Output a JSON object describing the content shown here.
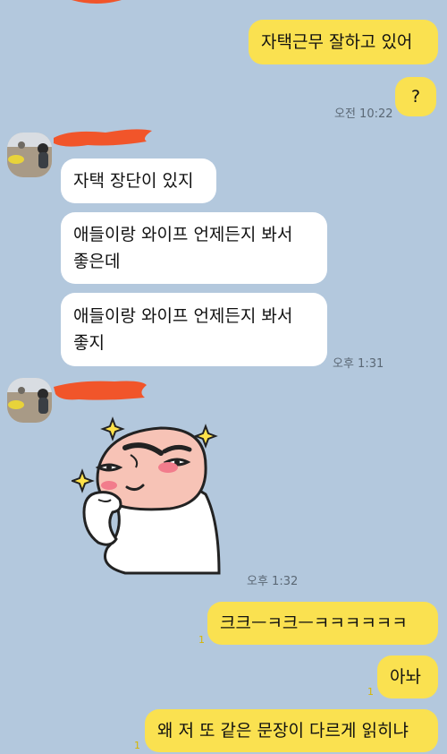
{
  "chat": {
    "me": {
      "msg1": "자택근무 잘하고 있어",
      "msg2": "?",
      "time1": "오전 10:22"
    },
    "them": {
      "msg1": "자택 장단이 있지",
      "msg2_l1": "애들이랑 와이프 언제든지 봐서",
      "msg2_l2": "좋은데",
      "msg3_l1": "애들이랑 와이프 언제든지 봐서",
      "msg3_l2": "좋지",
      "time1": "오후 1:31",
      "sticker_icon": "peach-character-smirk-sticker",
      "time2": "오후 1:32"
    },
    "reply": {
      "msg1": "크크ㅡㅋ크ㅡㅋㅋㅋㅋㅋㅋ",
      "msg2": "아놔",
      "msg3": "왜 저 또 같은 문장이 다르게 읽히냐",
      "unread": "1"
    }
  },
  "colors": {
    "background": "#b3c8dd",
    "my_bubble": "#fae150",
    "their_bubble": "#ffffff",
    "redaction": "#f1552a"
  }
}
